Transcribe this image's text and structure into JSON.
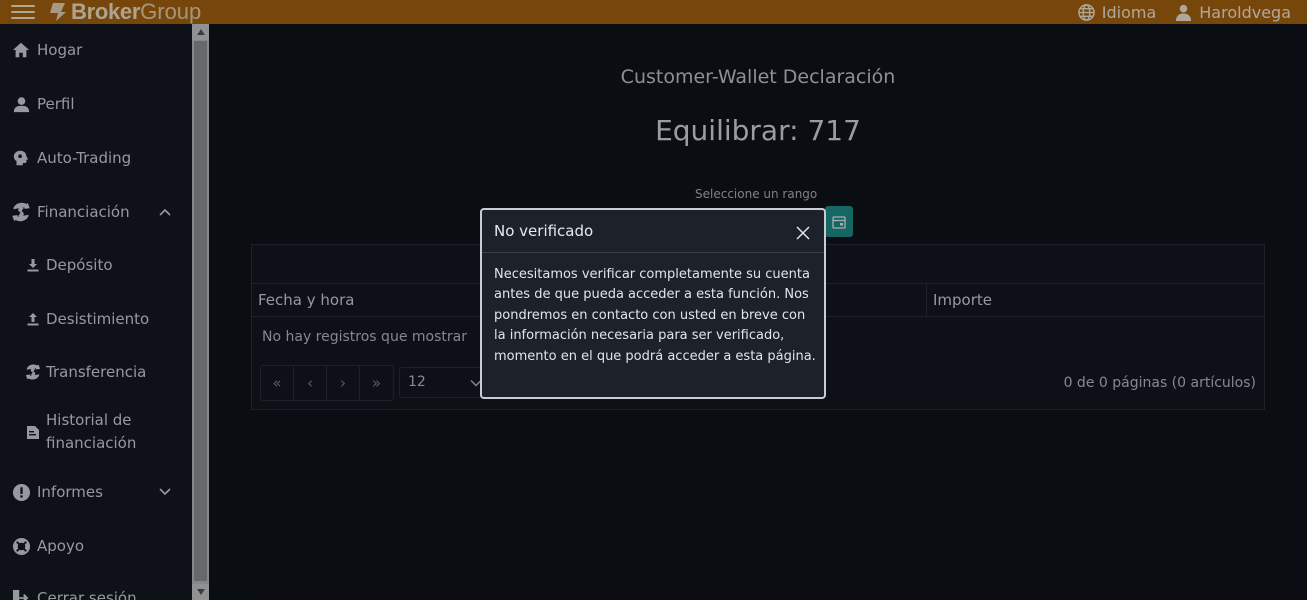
{
  "topbar": {
    "brand_strong": "Broker",
    "brand_light": "Group",
    "language_label": "Idioma",
    "user_label": "Haroldvega",
    "bg_color": "#a4620e"
  },
  "sidebar": {
    "items": [
      {
        "label": "Hogar",
        "icon": "home-icon"
      },
      {
        "label": "Perfil",
        "icon": "user-icon"
      },
      {
        "label": "Auto-Trading",
        "icon": "brain-icon"
      },
      {
        "label": "Financiación",
        "icon": "finance-cycle-icon",
        "expanded": true
      },
      {
        "label": "Depósito",
        "icon": "download-icon"
      },
      {
        "label": "Desistimiento",
        "icon": "upload-icon"
      },
      {
        "label": "Transferencia",
        "icon": "transfer-icon"
      },
      {
        "label": "Historial de financiación",
        "line1": "Historial de",
        "line2": "financiación",
        "icon": "ledger-icon"
      },
      {
        "label": "Informes",
        "icon": "alert-icon",
        "expanded": false
      },
      {
        "label": "Apoyo",
        "icon": "lifebuoy-icon"
      },
      {
        "label": "Cerrar sesión",
        "icon": "logout-icon"
      }
    ]
  },
  "main": {
    "title": "Customer-Wallet Declaración",
    "balance": "Equilibrar: 717",
    "range_label": "Seleccione un rango",
    "accent_color": "#1f8f8a",
    "table": {
      "columns": [
        "Fecha y hora",
        "Importe"
      ],
      "empty_message": "No hay registros que mostrar",
      "pager": [
        "«",
        "‹",
        "›",
        "»"
      ],
      "per_page": "12",
      "page_info": "0 de 0 páginas (0 artículos)"
    }
  },
  "modal": {
    "title": "No verificado",
    "body": "Necesitamos verificar completamente su cuenta antes de que pueda acceder a esta función. Nos pondremos en contacto con usted en breve con la información necesaria para ser verificado, momento en el que podrá acceder a esta página."
  }
}
